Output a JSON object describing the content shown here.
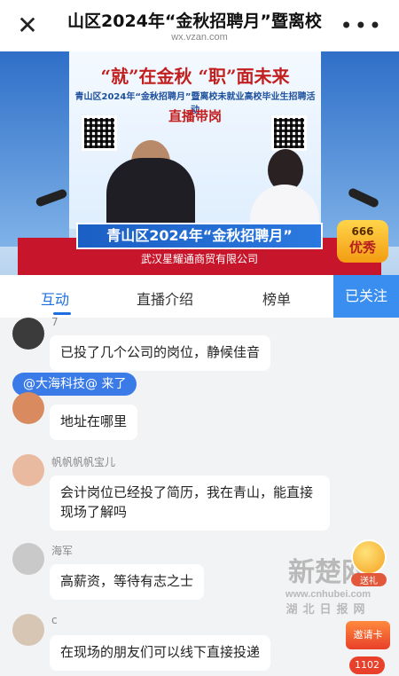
{
  "header": {
    "title": "山区2024年“金秋招聘月”暨离校",
    "url": "wx.vzan.com",
    "close_icon": "close-icon",
    "more_icon": "more-icon"
  },
  "video": {
    "slogan": "“就”在金秋  “职”面未来",
    "event": "青山区2024年“金秋招聘月”暨离校未就业高校毕业生招聘活动",
    "live_sell": "直播带岗",
    "caption_main": "青山区2024年“金秋招聘月”",
    "caption_sub": "武汉星耀通商贸有限公司",
    "badge_number": "666",
    "badge_label": "优秀"
  },
  "tabs": {
    "items": [
      "互动",
      "直播介绍",
      "榜单"
    ],
    "follow_label": "已关注",
    "active": "互动"
  },
  "chat": {
    "join_notice": "@大海科技@ 来了",
    "messages": [
      {
        "name": "7",
        "text": "已投了几个公司的岗位，静候佳音"
      },
      {
        "name": "",
        "text": "地址在哪里"
      },
      {
        "name": "帆帆帆帆宝儿",
        "text": "会计岗位已经投了简历，我在青山，能直接\n现场了解吗"
      },
      {
        "name": "海军",
        "text": "高薪资，等待有志之士"
      },
      {
        "name": "c",
        "text": "在现场的朋友们可以线下直接投递"
      }
    ]
  },
  "floating": {
    "gift_label": "送礼",
    "invite_label": "邀请卡",
    "like_count": "1102"
  },
  "watermark": {
    "logo": "新楚网",
    "url": "www.cnhubei.com",
    "sub": "湖北日报网"
  }
}
